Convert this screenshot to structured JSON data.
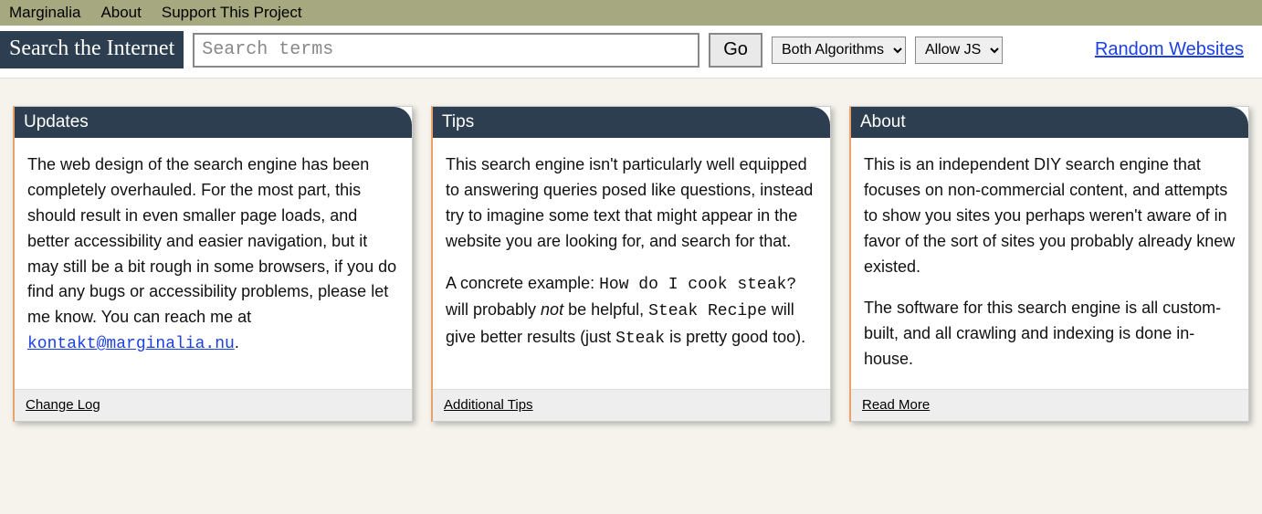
{
  "nav": {
    "items": [
      "Marginalia",
      "About",
      "Support This Project"
    ]
  },
  "search": {
    "label": "Search the Internet",
    "placeholder": "Search terms",
    "go": "Go",
    "algo_selected": "Both Algorithms",
    "js_selected": "Allow JS",
    "random_link": "Random Websites"
  },
  "cards": {
    "updates": {
      "title": "Updates",
      "body_pre": "The web design of the search engine has been completely overhauled. For the most part, this should result in even smaller page loads, and better accessibility and easier navigation, but it may still be a bit rough in some browsers, if you do find any bugs or accessibility problems, please let me know. You can reach me at ",
      "email": "kontakt@marginalia.nu",
      "body_post": ".",
      "footer": "Change Log"
    },
    "tips": {
      "title": "Tips",
      "p1": "This search engine isn't particularly well equipped to answering queries posed like questions, instead try to imagine some text that might appear in the website you are looking for, and search for that.",
      "p2_pre": "A concrete example: ",
      "p2_code1": "How do I cook steak?",
      "p2_mid1": " will probably ",
      "p2_em": "not",
      "p2_mid2": " be helpful, ",
      "p2_code2": "Steak Recipe",
      "p2_mid3": " will give better results (just ",
      "p2_code3": "Steak",
      "p2_post": " is pretty good too).",
      "footer": "Additional Tips"
    },
    "about": {
      "title": "About",
      "p1": "This is an independent DIY search engine that focuses on non-commercial content, and attempts to show you sites you perhaps weren't aware of in favor of the sort of sites you probably already knew existed.",
      "p2": "The software for this search engine is all custom-built, and all crawling and indexing is done in-house.",
      "footer": "Read More"
    }
  }
}
